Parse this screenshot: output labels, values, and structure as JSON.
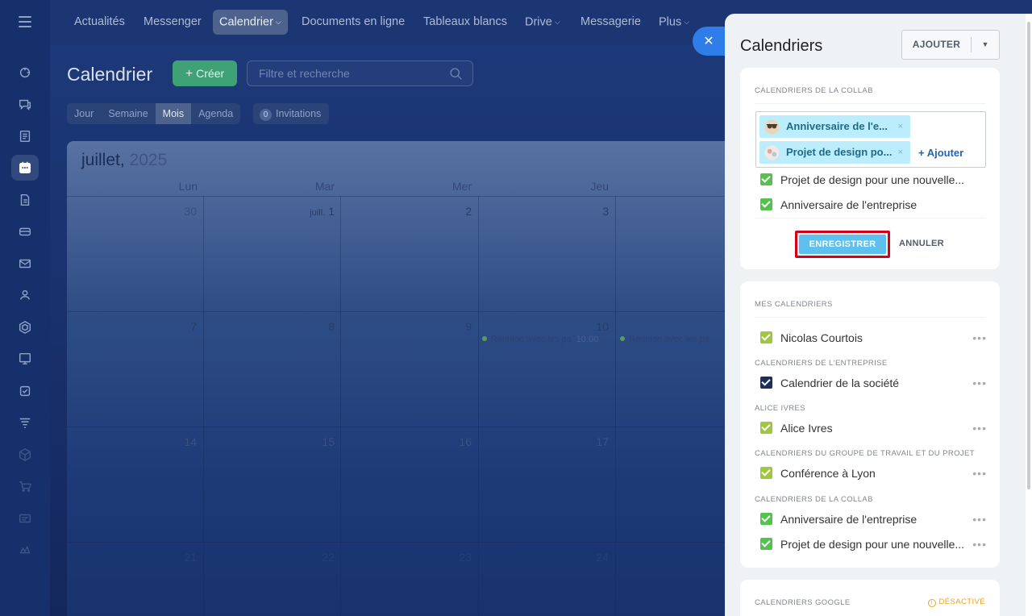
{
  "topnav": {
    "items": [
      {
        "label": "Actualités"
      },
      {
        "label": "Messenger"
      },
      {
        "label": "Calendrier",
        "chevron": "⌵"
      },
      {
        "label": "Documents en ligne"
      },
      {
        "label": "Tableaux blancs"
      },
      {
        "label": "Drive",
        "chevron": "⌵"
      },
      {
        "label": "Messagerie"
      },
      {
        "label": "Plus",
        "chevron": "⌵"
      }
    ]
  },
  "rail": {
    "icons": [
      "menu-icon",
      "pulse-icon",
      "chat-icon",
      "news-icon",
      "calendar-icon",
      "document-icon",
      "drive-icon",
      "mail-icon",
      "group-icon",
      "hexagon-icon",
      "board-icon",
      "task-icon",
      "filter-icon",
      "package-icon",
      "cart-icon",
      "card-icon",
      "crm-icon"
    ]
  },
  "header": {
    "title": "Calendrier",
    "create_label": "Créer",
    "search_placeholder": "Filtre et recherche",
    "views": [
      "Jour",
      "Semaine",
      "Mois",
      "Agenda"
    ],
    "active_view": "Mois",
    "invitations_count": "0",
    "invitations_label": "Invitations"
  },
  "month": {
    "month_name": "juillet,",
    "year": "2025",
    "weekdays": [
      "Lun",
      "Mar",
      "Mer",
      "Jeu"
    ],
    "rows": [
      [
        "30",
        "1",
        "2",
        "3"
      ],
      [
        "7",
        "8",
        "9",
        "10"
      ],
      [
        "14",
        "15",
        "16",
        "17"
      ],
      [
        "21",
        "22",
        "23",
        "24"
      ]
    ],
    "month_prefix": "juill.",
    "events": [
      {
        "title": "Réunion avec les pa",
        "time": "10:00"
      },
      {
        "title": "Réunion avec les pa"
      }
    ]
  },
  "panel": {
    "title": "Calendriers",
    "add_label": "AJOUTER",
    "collab_edit": {
      "heading": "CALENDRIERS DE LA COLLAB",
      "tags": [
        "Anniversaire de l'e...",
        "Projet de design po..."
      ],
      "tag_remove": "×",
      "add_link": "+ Ajouter",
      "items": [
        "Projet de design pour une nouvelle...",
        "Anniversaire de l'entreprise"
      ],
      "save_label": "ENREGISTRER",
      "cancel_label": "ANNULER"
    },
    "my_calendars": {
      "heading": "MES CALENDRIERS",
      "groups": [
        {
          "heading": "",
          "items": [
            {
              "label": "Nicolas Courtois",
              "color": "#9dc83b"
            }
          ]
        },
        {
          "heading": "CALENDRIERS DE L'ENTREPRISE",
          "items": [
            {
              "label": "Calendrier de la société",
              "color": "#1c2d5e"
            }
          ]
        },
        {
          "heading": "ALICE IVRES",
          "items": [
            {
              "label": "Alice Ivres",
              "color": "#9dc83b"
            }
          ]
        },
        {
          "heading": "CALENDRIERS DU GROUPE DE TRAVAIL ET DU PROJET",
          "items": [
            {
              "label": "Conférence à Lyon",
              "color": "#9dc83b"
            }
          ]
        },
        {
          "heading": "CALENDRIERS DE LA COLLAB",
          "items": [
            {
              "label": "Anniversaire de l'entreprise",
              "color": "#55c14f"
            },
            {
              "label": "Projet de design pour une nouvelle...",
              "color": "#55c14f"
            }
          ]
        }
      ],
      "more": "•••"
    },
    "google": {
      "heading": "CALENDRIERS GOOGLE",
      "status": "DÉSACTIVÉ"
    }
  },
  "colors": {
    "accent": "#2f7de8",
    "save": "#5ec0ef",
    "highlight": "#d4001a",
    "create": "#3fa277"
  }
}
